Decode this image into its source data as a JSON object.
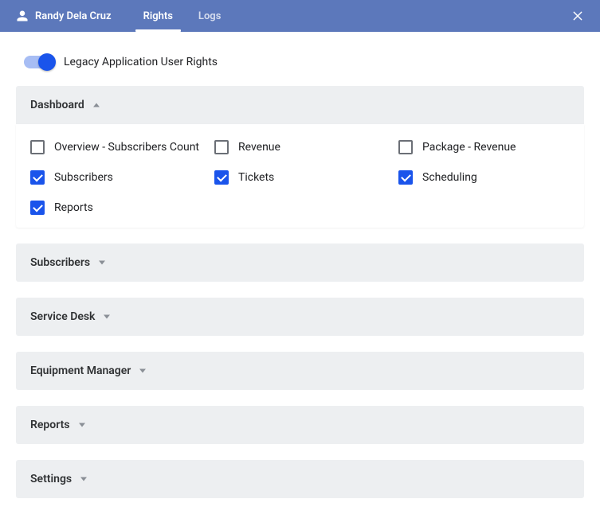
{
  "header": {
    "user_name": "Randy Dela Cruz",
    "tabs": [
      {
        "label": "Rights",
        "active": true
      },
      {
        "label": "Logs",
        "active": false
      }
    ]
  },
  "toggle": {
    "label": "Legacy Application User Rights",
    "on": true
  },
  "sections": [
    {
      "title": "Dashboard",
      "expanded": true,
      "permissions": [
        {
          "label": "Overview - Subscribers Count",
          "checked": false
        },
        {
          "label": "Revenue",
          "checked": false
        },
        {
          "label": "Package - Revenue",
          "checked": false
        },
        {
          "label": "Subscribers",
          "checked": true
        },
        {
          "label": "Tickets",
          "checked": true
        },
        {
          "label": "Scheduling",
          "checked": true
        },
        {
          "label": "Reports",
          "checked": true
        }
      ]
    },
    {
      "title": "Subscribers",
      "expanded": false
    },
    {
      "title": "Service Desk",
      "expanded": false
    },
    {
      "title": "Equipment Manager",
      "expanded": false
    },
    {
      "title": "Reports",
      "expanded": false
    },
    {
      "title": "Settings",
      "expanded": false
    }
  ]
}
